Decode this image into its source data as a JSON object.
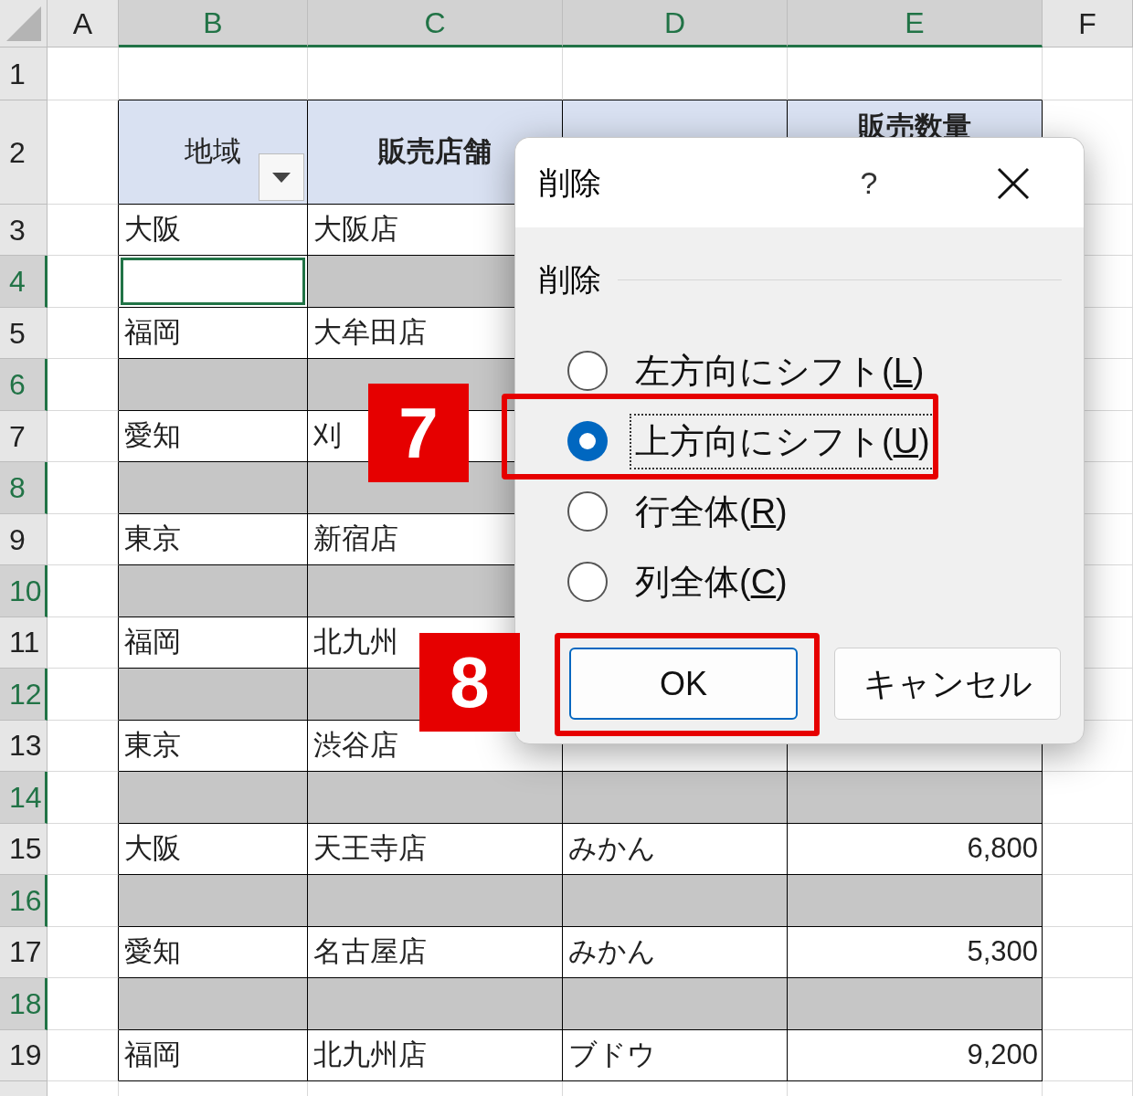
{
  "columns": [
    {
      "label": "A",
      "selected": false
    },
    {
      "label": "B",
      "selected": true
    },
    {
      "label": "C",
      "selected": true
    },
    {
      "label": "D",
      "selected": true
    },
    {
      "label": "E",
      "selected": true
    },
    {
      "label": "F",
      "selected": false
    }
  ],
  "rows": [
    {
      "number": "1",
      "selected": false,
      "kind": "blank"
    },
    {
      "number": "2",
      "selected": false,
      "kind": "header",
      "header_cells": {
        "B": {
          "text": "地域",
          "bold": false,
          "filter": true
        },
        "C": {
          "text": "販売店舗",
          "bold": true
        },
        "E": {
          "text": "販売数量",
          "bold": true
        }
      }
    },
    {
      "number": "3",
      "selected": false,
      "kind": "data",
      "cells": {
        "B": "大阪",
        "C": "大阪店"
      }
    },
    {
      "number": "4",
      "selected": true,
      "kind": "data",
      "active": true
    },
    {
      "number": "5",
      "selected": false,
      "kind": "data",
      "cells": {
        "B": "福岡",
        "C": "大牟田店"
      }
    },
    {
      "number": "6",
      "selected": true,
      "kind": "data"
    },
    {
      "number": "7",
      "selected": false,
      "kind": "data",
      "cells": {
        "B": "愛知",
        "C": "刈"
      }
    },
    {
      "number": "8",
      "selected": true,
      "kind": "data"
    },
    {
      "number": "9",
      "selected": false,
      "kind": "data",
      "cells": {
        "B": "東京",
        "C": "新宿店"
      }
    },
    {
      "number": "10",
      "selected": true,
      "kind": "data"
    },
    {
      "number": "11",
      "selected": false,
      "kind": "data",
      "cells": {
        "B": "福岡",
        "C": "北九州"
      }
    },
    {
      "number": "12",
      "selected": true,
      "kind": "data"
    },
    {
      "number": "13",
      "selected": false,
      "kind": "data",
      "cells": {
        "B": "東京",
        "C": "渋谷店"
      }
    },
    {
      "number": "14",
      "selected": true,
      "kind": "data"
    },
    {
      "number": "15",
      "selected": false,
      "kind": "data",
      "cells": {
        "B": "大阪",
        "C": "天王寺店",
        "D": "みかん",
        "E": "6,800"
      }
    },
    {
      "number": "16",
      "selected": true,
      "kind": "data"
    },
    {
      "number": "17",
      "selected": false,
      "kind": "data",
      "cells": {
        "B": "愛知",
        "C": "名古屋店",
        "D": "みかん",
        "E": "5,300"
      }
    },
    {
      "number": "18",
      "selected": true,
      "kind": "data"
    },
    {
      "number": "19",
      "selected": false,
      "kind": "data",
      "cells": {
        "B": "福岡",
        "C": "北九州店",
        "D": "ブドウ",
        "E": "9,200"
      }
    }
  ],
  "dialog": {
    "title": "削除",
    "help": "?",
    "group_label": "削除",
    "options": [
      {
        "label": "左方向にシフト(L)",
        "selected": false,
        "focused": false
      },
      {
        "label": "上方向にシフト(U)",
        "selected": true,
        "focused": true,
        "callout": "7"
      },
      {
        "label": "行全体(R)",
        "selected": false,
        "focused": false
      },
      {
        "label": "列全体(C)",
        "selected": false,
        "focused": false
      }
    ],
    "buttons": [
      {
        "label": "OK",
        "default": true,
        "callout": "8"
      },
      {
        "label": "キャンセル",
        "default": false
      }
    ]
  }
}
